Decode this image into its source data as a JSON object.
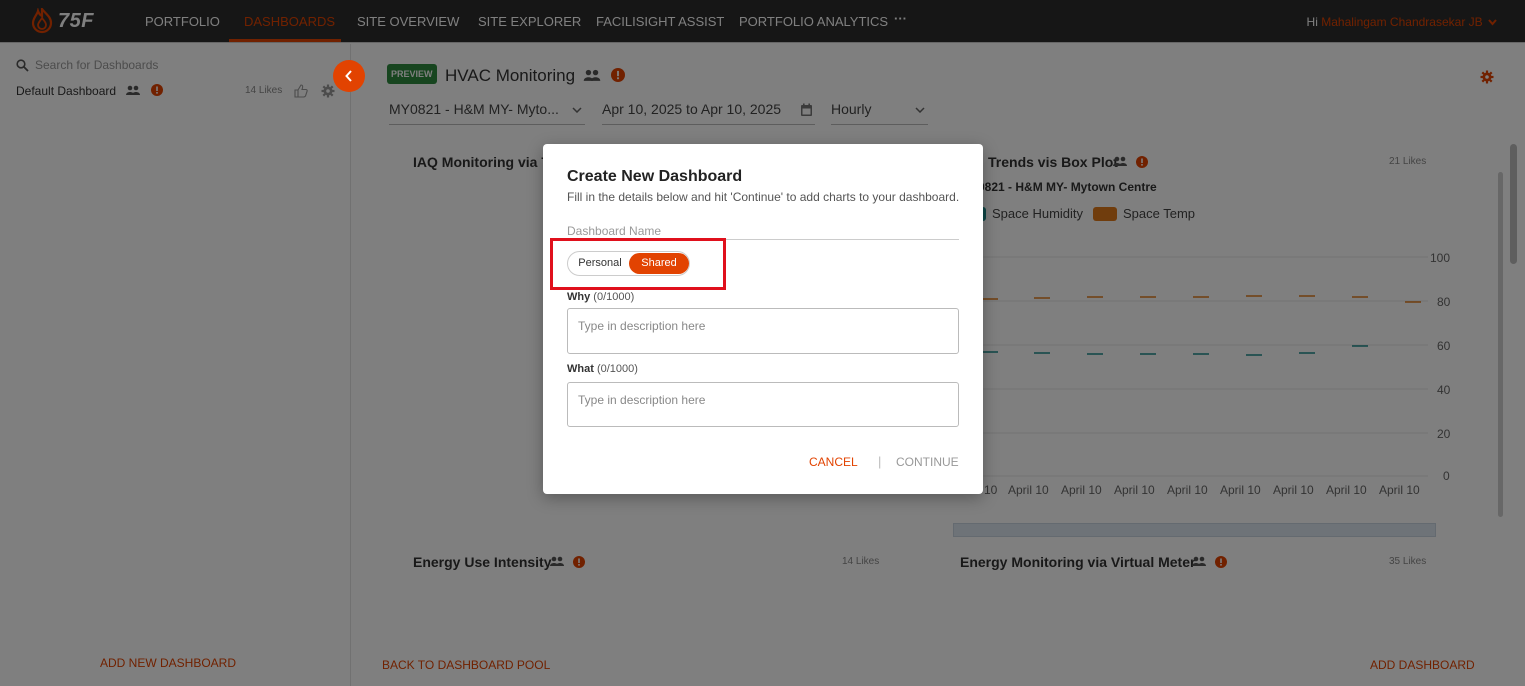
{
  "nav": {
    "logo_text": "75F",
    "items": [
      {
        "label": "PORTFOLIO",
        "active": false
      },
      {
        "label": "DASHBOARDS",
        "active": true
      },
      {
        "label": "SITE OVERVIEW",
        "active": false
      },
      {
        "label": "SITE EXPLORER",
        "active": false
      },
      {
        "label": "FACILISIGHT ASSIST",
        "active": false
      },
      {
        "label": "PORTFOLIO ANALYTICS",
        "active": false
      }
    ],
    "more_label": "···",
    "greeting": "Hi",
    "user_name": "Mahalingam Chandrasekar JB",
    "accent_color": "#e24301"
  },
  "sidebar": {
    "search_placeholder": "Search for Dashboards",
    "dashboards": [
      {
        "name": "Default Dashboard",
        "likes": "14 Likes"
      }
    ],
    "add_new_label": "ADD NEW DASHBOARD"
  },
  "main": {
    "preview_badge": "PREVIEW",
    "title": "HVAC Monitoring",
    "filters": {
      "site": "MY0821 - H&M MY- Myto...",
      "date_range": "Apr 10, 2025 to Apr 10, 2025",
      "interval": "Hourly"
    },
    "cards": [
      {
        "title": "IAQ Monitoring via Te",
        "likes": ""
      },
      {
        "title": "Trends vis Box Plot",
        "likes": "21 Likes",
        "subtitle": "0821 - H&M MY- Mytown Centre",
        "legend": [
          {
            "name": "Space Humidity",
            "color": "#1a8a8a"
          },
          {
            "name": "Space Temp",
            "color": "#e07b1a"
          }
        ]
      },
      {
        "title": "Energy Use Intensity",
        "likes": "14 Likes"
      },
      {
        "title": "Energy Monitoring via Virtual Meter",
        "likes": "35 Likes"
      }
    ],
    "y_ticks": [
      "100",
      "80",
      "60",
      "40",
      "20",
      "0"
    ],
    "x_ticks": [
      "10",
      "April 10",
      "April 10",
      "April 10",
      "April 10",
      "April 10",
      "April 10",
      "April 10",
      "April 10"
    ],
    "back_label": "BACK TO DASHBOARD POOL",
    "add_dashboard_label": "ADD DASHBOARD"
  },
  "modal": {
    "title": "Create New Dashboard",
    "subtitle": "Fill in the details below and hit 'Continue' to add charts to your dashboard.",
    "name_placeholder": "Dashboard Name",
    "toggle": {
      "personal": "Personal",
      "shared": "Shared",
      "selected": "Shared"
    },
    "why_label": "Why",
    "why_count": "(0/1000)",
    "why_placeholder": "Type in description here",
    "what_label": "What",
    "what_count": "(0/1000)",
    "what_placeholder": "Type in description here",
    "cancel_label": "CANCEL",
    "separator": "|",
    "continue_label": "CONTINUE"
  }
}
